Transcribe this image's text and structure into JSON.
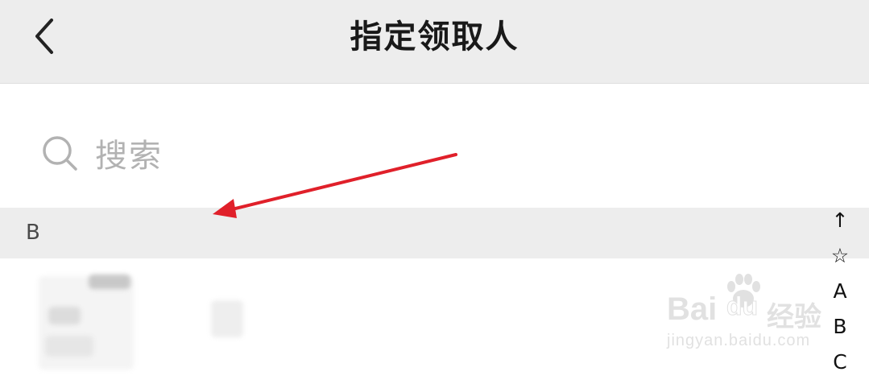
{
  "header": {
    "title": "指定领取人",
    "back_icon": "chevron-left-icon"
  },
  "search": {
    "placeholder": "搜索",
    "icon": "search-icon"
  },
  "contacts": {
    "section_letter": "B"
  },
  "index_bar": {
    "items": [
      "↑",
      "☆",
      "A",
      "B",
      "C"
    ]
  },
  "watermark": {
    "brand_left": "Bai",
    "brand_right": "du",
    "brand_cn": "经验",
    "url": "jingyan.baidu.com"
  },
  "annotation": {
    "color": "#e0202a"
  }
}
